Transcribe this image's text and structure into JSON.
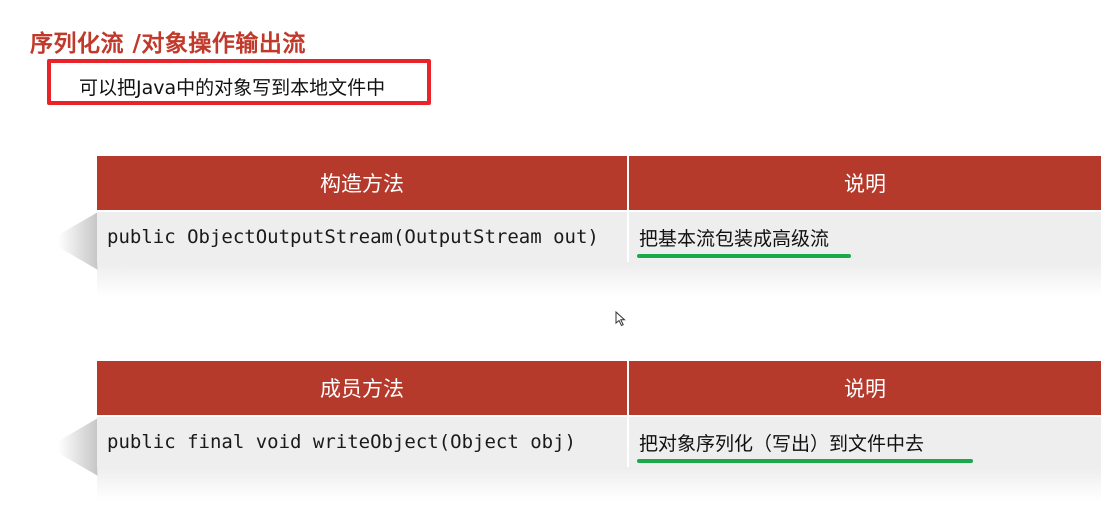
{
  "title": "序列化流 /对象操作输出流",
  "note": "可以把Java中的对象写到本地文件中",
  "constructor_table": {
    "headers": [
      "构造方法",
      "说明"
    ],
    "rows": [
      {
        "method": "public ObjectOutputStream(OutputStream out)",
        "description": "把基本流包装成高级流"
      }
    ]
  },
  "member_table": {
    "headers": [
      "成员方法",
      "说明"
    ],
    "rows": [
      {
        "method": "public final void writeObject(Object obj)",
        "description": "把对象序列化（写出）到文件中去"
      }
    ]
  },
  "colors": {
    "title": "#c0392b",
    "header_bg": "#b53a2b",
    "note_border": "#e8232a",
    "underline": "#1aa84a",
    "row_bg": "#eeeeee"
  },
  "icons": [
    "mouse-cursor-icon"
  ]
}
